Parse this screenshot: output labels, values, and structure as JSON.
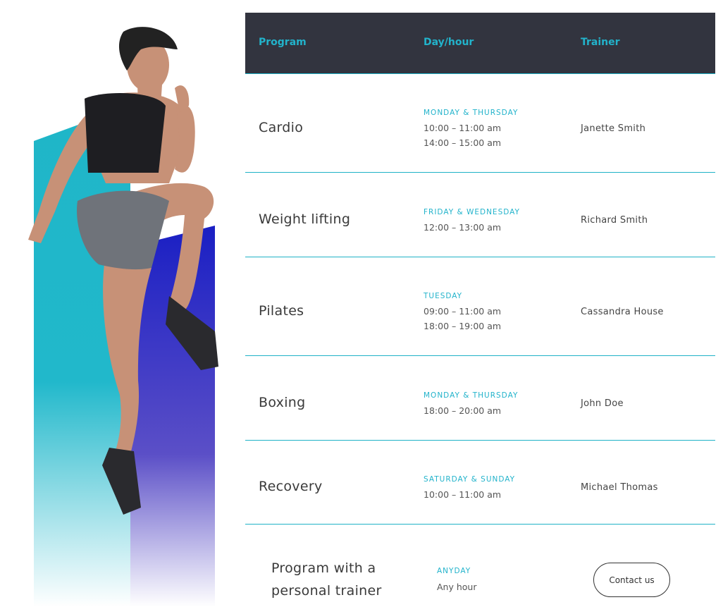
{
  "table": {
    "headers": [
      "Program",
      "Day/hour",
      "Trainer"
    ],
    "rows": [
      {
        "program": "Cardio",
        "days": "MONDAY & THURSDAY",
        "hours": [
          "10:00 – 11:00 am",
          "14:00 – 15:00 am"
        ],
        "trainer": "Janette Smith"
      },
      {
        "program": "Weight lifting",
        "days": "FRIDAY & WEDNESDAY",
        "hours": [
          "12:00 – 13:00 am"
        ],
        "trainer": "Richard Smith"
      },
      {
        "program": "Pilates",
        "days": "TUESDAY",
        "hours": [
          "09:00 – 11:00 am",
          "18:00 – 19:00 am"
        ],
        "trainer": "Cassandra House"
      },
      {
        "program": "Boxing",
        "days": "MONDAY & THURSDAY",
        "hours": [
          "18:00 – 20:00 am"
        ],
        "trainer": "John Doe"
      },
      {
        "program": "Recovery",
        "days": "SATURDAY & SUNDAY",
        "hours": [
          "10:00 – 11:00 am"
        ],
        "trainer": "Michael Thomas"
      }
    ],
    "personal": {
      "program": [
        "Program with a",
        "personal trainer"
      ],
      "days": "ANYDAY",
      "hours": "Any hour",
      "contact_label": "Contact us"
    }
  },
  "colors": {
    "accent": "#22b3cb",
    "header_bg": "#32343f",
    "teal_bar": "#1fb6c8",
    "blue_bar": "#3a3dd0"
  }
}
